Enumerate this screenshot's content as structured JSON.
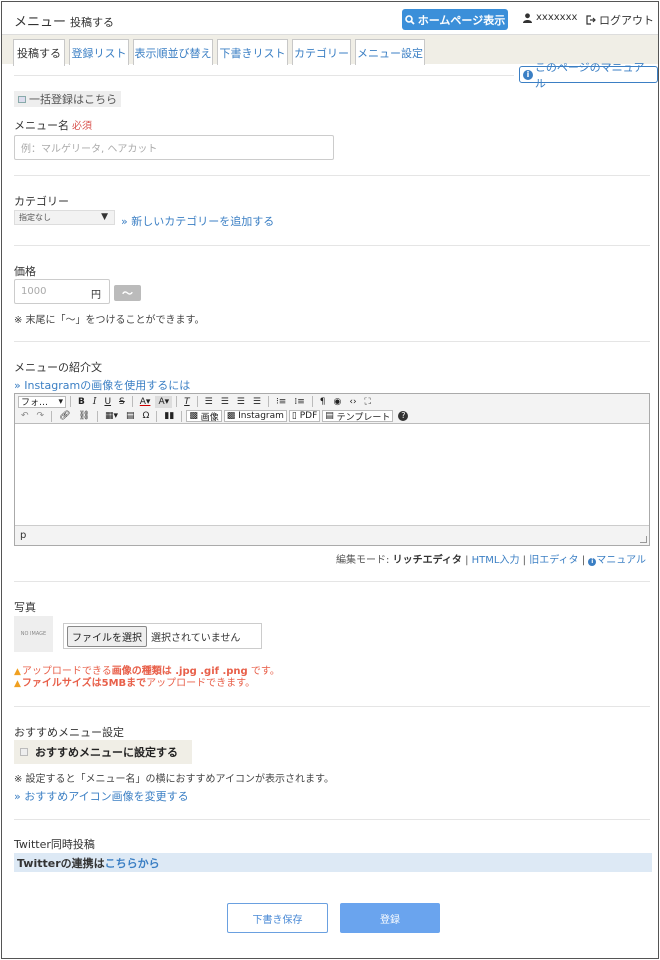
{
  "header": {
    "title": "メニュー",
    "subtitle": "投稿する",
    "homepage_button": "ホームページ表示",
    "username": "xxxxxxx",
    "logout": "ログアウト"
  },
  "tabs": [
    "投稿する",
    "登録リスト",
    "表示順並び替え",
    "下書きリスト",
    "カテゴリー",
    "メニュー設定"
  ],
  "manual_link": "このページのマニュアル",
  "bulk_link": "一括登録はこちら",
  "menu_name": {
    "label": "メニュー名",
    "required": "必須",
    "placeholder": "例：マルゲリータ, ヘアカット"
  },
  "category": {
    "label": "カテゴリー",
    "selected": "指定なし",
    "add_link": "新しいカテゴリーを追加する"
  },
  "price": {
    "label": "価格",
    "placeholder": "1000",
    "unit": "円",
    "tilde_button": "～",
    "note": "※ 末尾に「～」をつけることができます。"
  },
  "description": {
    "label": "メニューの紹介文",
    "instagram_link": "Instagramの画像を使用するには",
    "toolbar": {
      "format": "フォ…",
      "image": "画像",
      "instagram": "Instagram",
      "pdf": "PDF",
      "template": "テンプレート"
    },
    "status_path": "p"
  },
  "edit_mode": {
    "label": "編集モード:",
    "current": "リッチエディタ",
    "html": "HTML入力",
    "old": "旧エディタ",
    "manual": "マニュアル"
  },
  "photo": {
    "label": "写真",
    "thumb_text": "NO IMAGE",
    "file_button": "ファイルを選択",
    "file_status": "選択されていません",
    "warn1_a": "アップロードできる",
    "warn1_b": "画像の種類は .jpg .gif .png",
    "warn1_c": " です。",
    "warn2_a": "ファイルサイズは5MBまで",
    "warn2_b": "アップロードできます。"
  },
  "recommend": {
    "label": "おすすめメニュー設定",
    "checkbox_label": "おすすめメニューに設定する",
    "note": "※ 設定すると「メニュー名」の横におすすめアイコンが表示されます。",
    "change_link": "おすすめアイコン画像を変更する"
  },
  "twitter": {
    "label": "Twitter同時投稿",
    "box_text": "Twitterの連携は",
    "box_link": "こちらから"
  },
  "buttons": {
    "draft": "下書き保存",
    "submit": "登録"
  }
}
